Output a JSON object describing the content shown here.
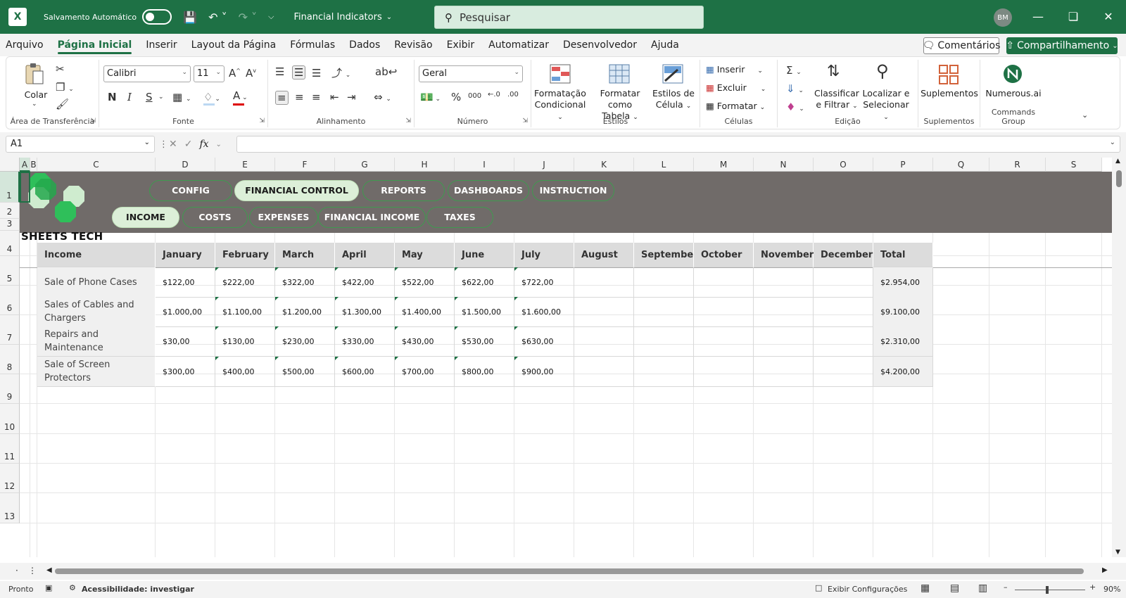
{
  "titlebar": {
    "app_icon": "excel-icon",
    "autosave_label": "Salvamento Automático",
    "doc_title": "Financial Indicators",
    "search_placeholder": "Pesquisar",
    "avatar_initials": "BM"
  },
  "menu": {
    "tabs": [
      "Arquivo",
      "Página Inicial",
      "Inserir",
      "Layout da Página",
      "Fórmulas",
      "Dados",
      "Revisão",
      "Exibir",
      "Automatizar",
      "Desenvolvedor",
      "Ajuda"
    ],
    "active": "Página Inicial",
    "comments_label": "Comentários",
    "share_label": "Compartilhamento"
  },
  "ribbon": {
    "clipboard": {
      "paste_label": "Colar",
      "group_label": "Área de Transferência"
    },
    "font": {
      "name": "Calibri",
      "size": "11",
      "bold": "N",
      "italic": "I",
      "underline": "S",
      "group_label": "Fonte"
    },
    "alignment": {
      "group_label": "Alinhamento"
    },
    "number": {
      "format": "Geral",
      "group_label": "Número"
    },
    "styles": {
      "cond_format_1": "Formatação",
      "cond_format_2": "Condicional",
      "format_table_1": "Formatar como",
      "format_table_2": "Tabela",
      "cell_styles_1": "Estilos de",
      "cell_styles_2": "Célula",
      "group_label": "Estilos"
    },
    "cells": {
      "insert": "Inserir",
      "delete": "Excluir",
      "format": "Formatar",
      "group_label": "Células"
    },
    "editing": {
      "sort_1": "Classificar",
      "sort_2": "e Filtrar",
      "find_1": "Localizar e",
      "find_2": "Selecionar",
      "group_label": "Edição"
    },
    "addins": {
      "label": "Suplementos",
      "group_label": "Suplementos"
    },
    "commands": {
      "label": "Numerous.ai",
      "group_label": "Commands Group"
    }
  },
  "formula_bar": {
    "name_box": "A1",
    "fx": "fx",
    "formula": ""
  },
  "grid": {
    "columns": [
      "A",
      "B",
      "C",
      "D",
      "E",
      "F",
      "G",
      "H",
      "I",
      "J",
      "K",
      "L",
      "M",
      "N",
      "O",
      "P",
      "Q",
      "R",
      "S"
    ],
    "rows": [
      "1",
      "2",
      "3",
      "4",
      "5",
      "6",
      "7",
      "8",
      "9",
      "10",
      "11",
      "12",
      "13"
    ]
  },
  "banner": {
    "nav_top": [
      "CONFIG",
      "FINANCIAL CONTROL",
      "REPORTS",
      "DASHBOARDS",
      "INSTRUCTION"
    ],
    "nav_top_active": "FINANCIAL CONTROL",
    "nav_sub": [
      "INCOME",
      "COSTS",
      "EXPENSES",
      "FINANCIAL INCOME",
      "TAXES"
    ],
    "nav_sub_active": "INCOME",
    "brand": "SHEETS TECH"
  },
  "table": {
    "headers": [
      "Income",
      "January",
      "February",
      "March",
      "April",
      "May",
      "June",
      "July",
      "August",
      "September",
      "October",
      "November",
      "December",
      "Total"
    ],
    "rows": [
      {
        "label": "Sale of Phone Cases",
        "values": [
          "$122,00",
          "$222,00",
          "$322,00",
          "$422,00",
          "$522,00",
          "$622,00",
          "$722,00",
          "",
          "",
          "",
          "",
          ""
        ],
        "total": "$2.954,00"
      },
      {
        "label": "Sales of Cables and Chargers",
        "values": [
          "$1.000,00",
          "$1.100,00",
          "$1.200,00",
          "$1.300,00",
          "$1.400,00",
          "$1.500,00",
          "$1.600,00",
          "",
          "",
          "",
          "",
          ""
        ],
        "total": "$9.100,00"
      },
      {
        "label": "Repairs and Maintenance",
        "values": [
          "$30,00",
          "$130,00",
          "$230,00",
          "$330,00",
          "$430,00",
          "$530,00",
          "$630,00",
          "",
          "",
          "",
          "",
          ""
        ],
        "total": "$2.310,00"
      },
      {
        "label": "Sale of Screen Protectors",
        "values": [
          "$300,00",
          "$400,00",
          "$500,00",
          "$600,00",
          "$700,00",
          "$800,00",
          "$900,00",
          "",
          "",
          "",
          "",
          ""
        ],
        "total": "$4.200,00"
      }
    ]
  },
  "statusbar": {
    "ready": "Pronto",
    "accessibility": "Acessibilidade: investigar",
    "display_settings": "Exibir Configurações",
    "zoom": "90%"
  },
  "colors": {
    "excel_green": "#1e7145",
    "banner_gray": "#706b69",
    "pill_active": "#dcefd8"
  }
}
